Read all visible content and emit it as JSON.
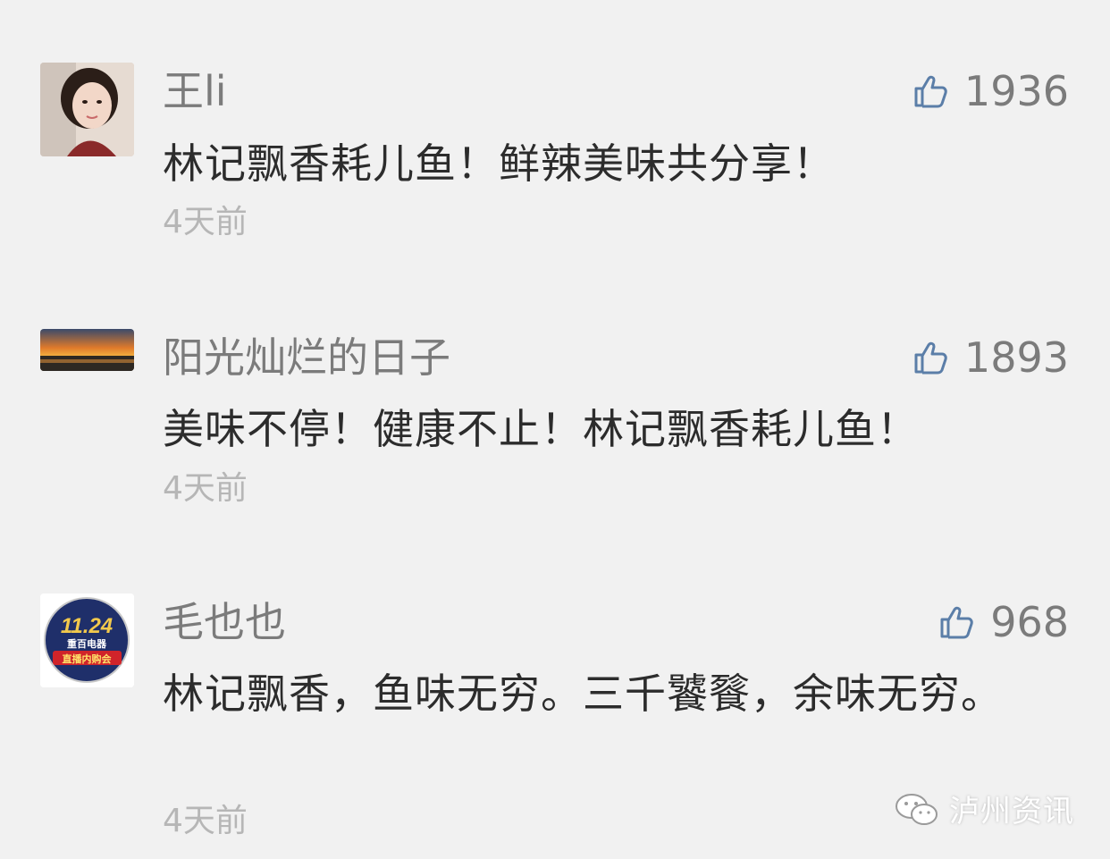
{
  "comments": [
    {
      "name": "王li",
      "likes": "1936",
      "text": "林记飘香耗儿鱼！鲜辣美味共分享！",
      "time": "4天前"
    },
    {
      "name": "阳光灿烂的日子",
      "likes": "1893",
      "text": "美味不停！健康不止！林记飘香耗儿鱼！",
      "time": "4天前"
    },
    {
      "name": "毛也也",
      "likes": "968",
      "text": "林记飘香，鱼味无穷。三千饕餮，余味无穷。",
      "time": "4天前"
    }
  ],
  "avatar3_badge": {
    "number": "11.24",
    "line1": "重百电器",
    "line2": "直播内购会"
  },
  "watermark": {
    "text": "泸州资讯",
    "icon": "wechat-icon"
  },
  "colors": {
    "background": "#f1f1f1",
    "like_icon": "#5b7ea8",
    "name_text": "#7b7b7b",
    "body_text": "#2c2c2c",
    "time_text": "#b6b6b6"
  }
}
